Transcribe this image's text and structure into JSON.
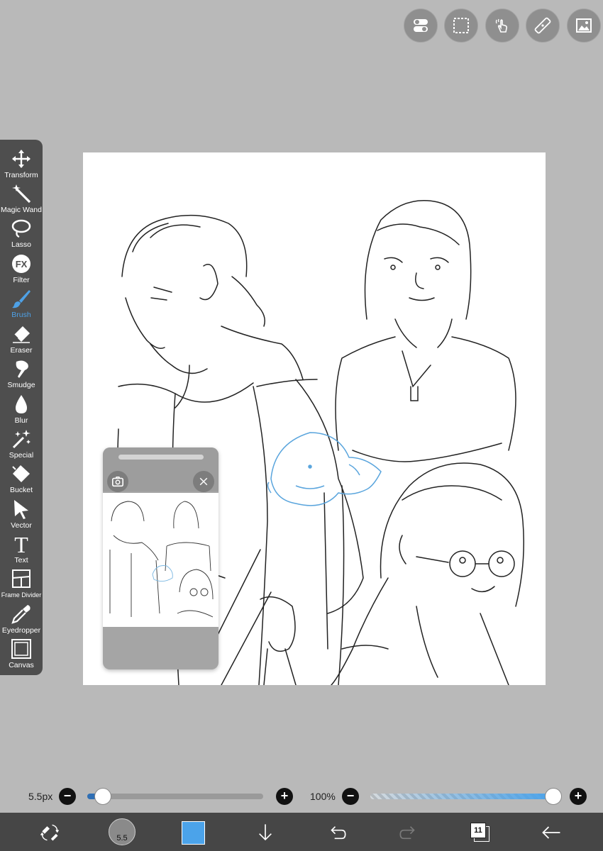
{
  "top_buttons": [
    {
      "name": "toggle-icon"
    },
    {
      "name": "selection-icon"
    },
    {
      "name": "hand-gesture-icon"
    },
    {
      "name": "ruler-icon"
    },
    {
      "name": "image-icon"
    }
  ],
  "toolbar": {
    "items": [
      {
        "label": "Transform",
        "icon": "transform-icon"
      },
      {
        "label": "Magic Wand",
        "icon": "magic-wand-icon"
      },
      {
        "label": "Lasso",
        "icon": "lasso-icon"
      },
      {
        "label": "Filter",
        "icon": "fx-icon",
        "icon_text": "FX"
      },
      {
        "label": "Brush",
        "icon": "brush-icon",
        "active": true
      },
      {
        "label": "Eraser",
        "icon": "eraser-icon"
      },
      {
        "label": "Smudge",
        "icon": "smudge-icon"
      },
      {
        "label": "Blur",
        "icon": "blur-icon"
      },
      {
        "label": "Special",
        "icon": "special-icon"
      },
      {
        "label": "Bucket",
        "icon": "bucket-icon"
      },
      {
        "label": "Vector",
        "icon": "vector-icon"
      },
      {
        "label": "Text",
        "icon": "text-icon",
        "icon_text": "T"
      },
      {
        "label": "Frame Divider",
        "icon": "frame-divider-icon"
      },
      {
        "label": "Eyedropper",
        "icon": "eyedropper-icon"
      },
      {
        "label": "Canvas",
        "icon": "canvas-icon"
      }
    ],
    "active_color": "#4ea1e6"
  },
  "reference_window": {
    "camera_icon": "camera-icon",
    "close_icon": "close-icon"
  },
  "brush_size": {
    "value_label": "5.5px",
    "fraction": 0.09
  },
  "opacity": {
    "value_label": "100%",
    "fraction": 1.0
  },
  "bottom_bar": {
    "brush_preview_label": "5.5",
    "color": "#4ba3ea",
    "layer_count": "11",
    "icons": [
      "swap-tools-icon",
      "download-icon",
      "undo-icon",
      "redo-icon",
      "layers-icon",
      "back-arrow-icon"
    ]
  },
  "colors": {
    "background": "#b9b9b9",
    "toolbar": "#4e4e4e",
    "bottom_bar": "#464646",
    "accent": "#4ea1e6"
  }
}
